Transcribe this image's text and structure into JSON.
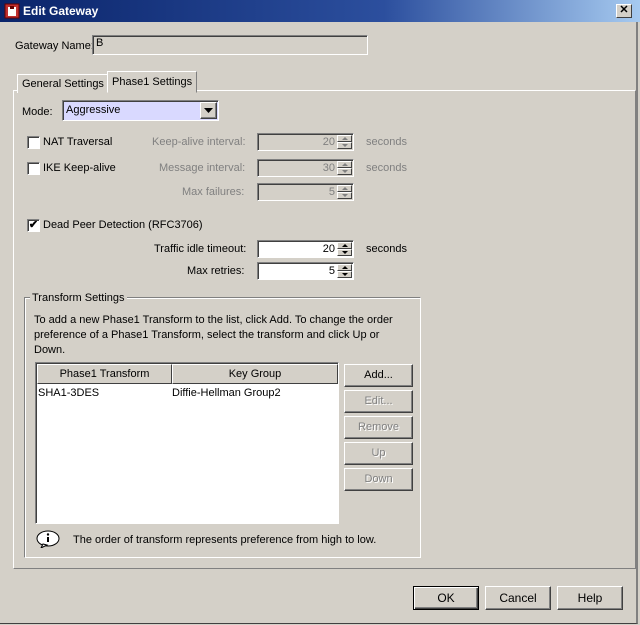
{
  "window": {
    "title": "Edit Gateway",
    "close_glyph": "✕"
  },
  "gateway": {
    "name_label": "Gateway Name:",
    "name_value": "B"
  },
  "tabs": [
    {
      "label": "General Settings",
      "active": false
    },
    {
      "label": "Phase1 Settings",
      "active": true
    }
  ],
  "mode": {
    "label": "Mode:",
    "selected": "Aggressive"
  },
  "nat": {
    "checkbox_label": "NAT Traversal",
    "checked": false,
    "interval_label": "Keep-alive interval:",
    "interval_value": "20",
    "unit": "seconds"
  },
  "ike": {
    "checkbox_label": "IKE Keep-alive",
    "checked": false,
    "interval_label": "Message interval:",
    "interval_value": "30",
    "unit": "seconds",
    "failures_label": "Max failures:",
    "failures_value": "5"
  },
  "dpd": {
    "checkbox_label": "Dead Peer Detection (RFC3706)",
    "checked": true,
    "check_glyph": "✔",
    "idle_label": "Traffic idle timeout:",
    "idle_value": "20",
    "unit": "seconds",
    "retries_label": "Max retries:",
    "retries_value": "5"
  },
  "transform": {
    "group_title": "Transform Settings",
    "description": "To add a new Phase1 Transform to the list, click Add. To change the order preference of a Phase1 Transform, select the transform and click Up or Down.",
    "columns": [
      "Phase1 Transform",
      "Key Group"
    ],
    "rows": [
      {
        "transform": "SHA1-3DES",
        "key_group": "Diffie-Hellman Group2"
      }
    ],
    "buttons": {
      "add": "Add...",
      "edit": "Edit...",
      "remove": "Remove",
      "up": "Up",
      "down": "Down"
    },
    "note": "The order of transform represents preference from high to low."
  },
  "footer": {
    "ok": "OK",
    "cancel": "Cancel",
    "help": "Help"
  }
}
